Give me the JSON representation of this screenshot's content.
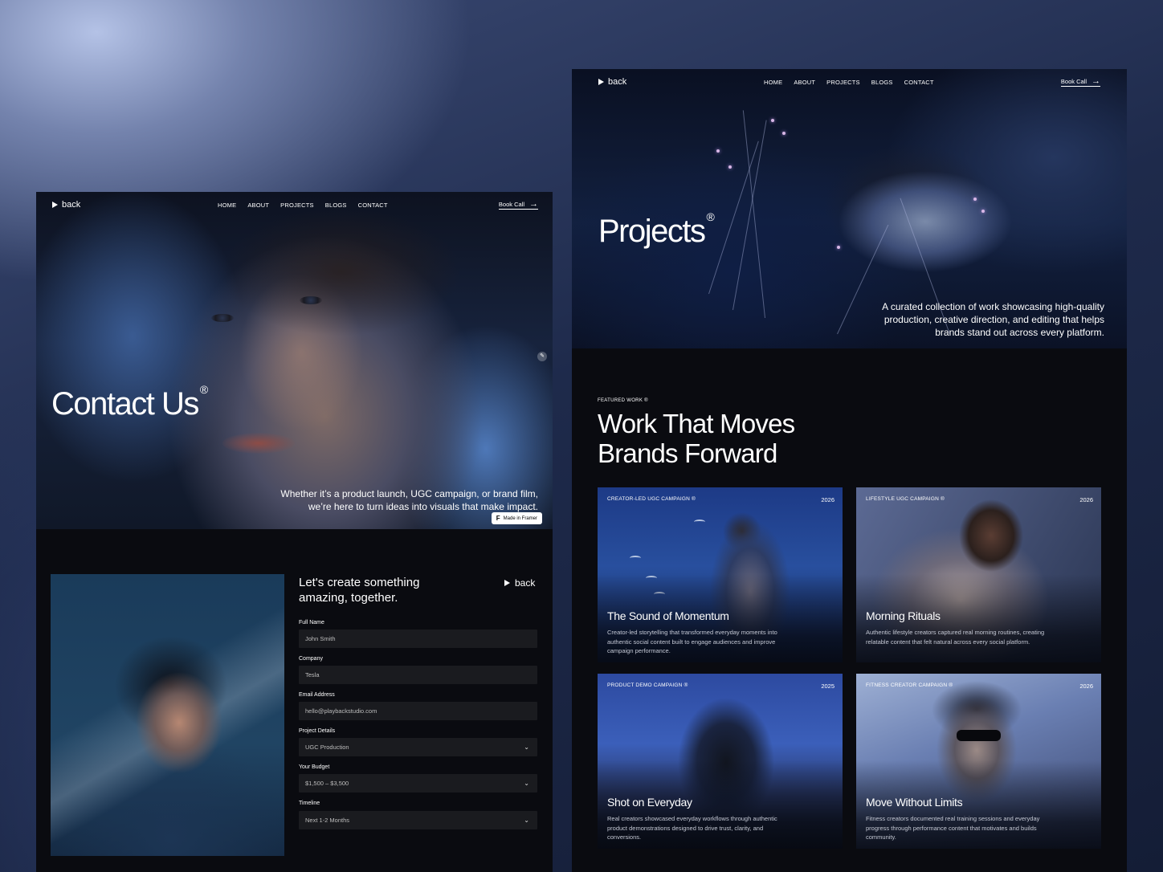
{
  "contact_page": {
    "nav": {
      "logo": "back",
      "menu": [
        "HOME",
        "ABOUT",
        "PROJECTS",
        "BLOGS",
        "CONTACT"
      ],
      "cta": "Book Call"
    },
    "hero": {
      "title": "Contact Us",
      "title_mark": "®",
      "subtitle": "Whether it’s a product launch, UGC campaign, or brand film, we’re here to turn ideas into visuals that make impact.",
      "badge": "Made in Framer"
    },
    "form": {
      "heading": "Let's create something amazing, together.",
      "back_label": "back",
      "fields": [
        {
          "label": "Full Name",
          "value": "John Smith",
          "type": "input"
        },
        {
          "label": "Company",
          "value": "Tesla",
          "type": "input"
        },
        {
          "label": "Email Address",
          "value": "hello@playbackstudio.com",
          "type": "input"
        },
        {
          "label": "Project Details",
          "value": "UGC Production",
          "type": "select"
        },
        {
          "label": "Your Budget",
          "value": "$1,500 – $3,500",
          "type": "select"
        },
        {
          "label": "Timeline",
          "value": "Next 1-2 Months",
          "type": "select"
        }
      ]
    }
  },
  "projects_page": {
    "nav": {
      "logo": "back",
      "menu": [
        "HOME",
        "ABOUT",
        "PROJECTS",
        "BLOGS",
        "CONTACT"
      ],
      "cta": "Book Call"
    },
    "hero": {
      "title": "Projects",
      "title_mark": "®",
      "subtitle": "A curated collection of work showcasing high-quality production, creative direction, and editing that helps brands stand out across every platform."
    },
    "featured": {
      "label": "FEATURED WORK ®",
      "heading": "Work That Moves Brands Forward",
      "projects": [
        {
          "category": "CREATOR-LED UGC CAMPAIGN ®",
          "year": "2026",
          "title": "The Sound of Momentum",
          "description": "Creator-led storytelling that transformed everyday moments into authentic social content built to engage audiences and improve campaign performance."
        },
        {
          "category": "LIFESTYLE UGC CAMPAIGN ®",
          "year": "2026",
          "title": "Morning Rituals",
          "description": "Authentic lifestyle creators captured real morning routines, creating relatable content that felt natural across every social platform."
        },
        {
          "category": "PRODUCT DEMO CAMPAIGN ®",
          "year": "2025",
          "title": "Shot on Everyday",
          "description": "Real creators showcased everyday workflows through authentic product demonstrations designed to drive trust, clarity, and conversions."
        },
        {
          "category": "FITNESS CREATOR CAMPAIGN ®",
          "year": "2026",
          "title": "Move Without Limits",
          "description": "Fitness creators documented real training sessions and everyday progress through performance content that motivates and builds community."
        }
      ]
    }
  }
}
